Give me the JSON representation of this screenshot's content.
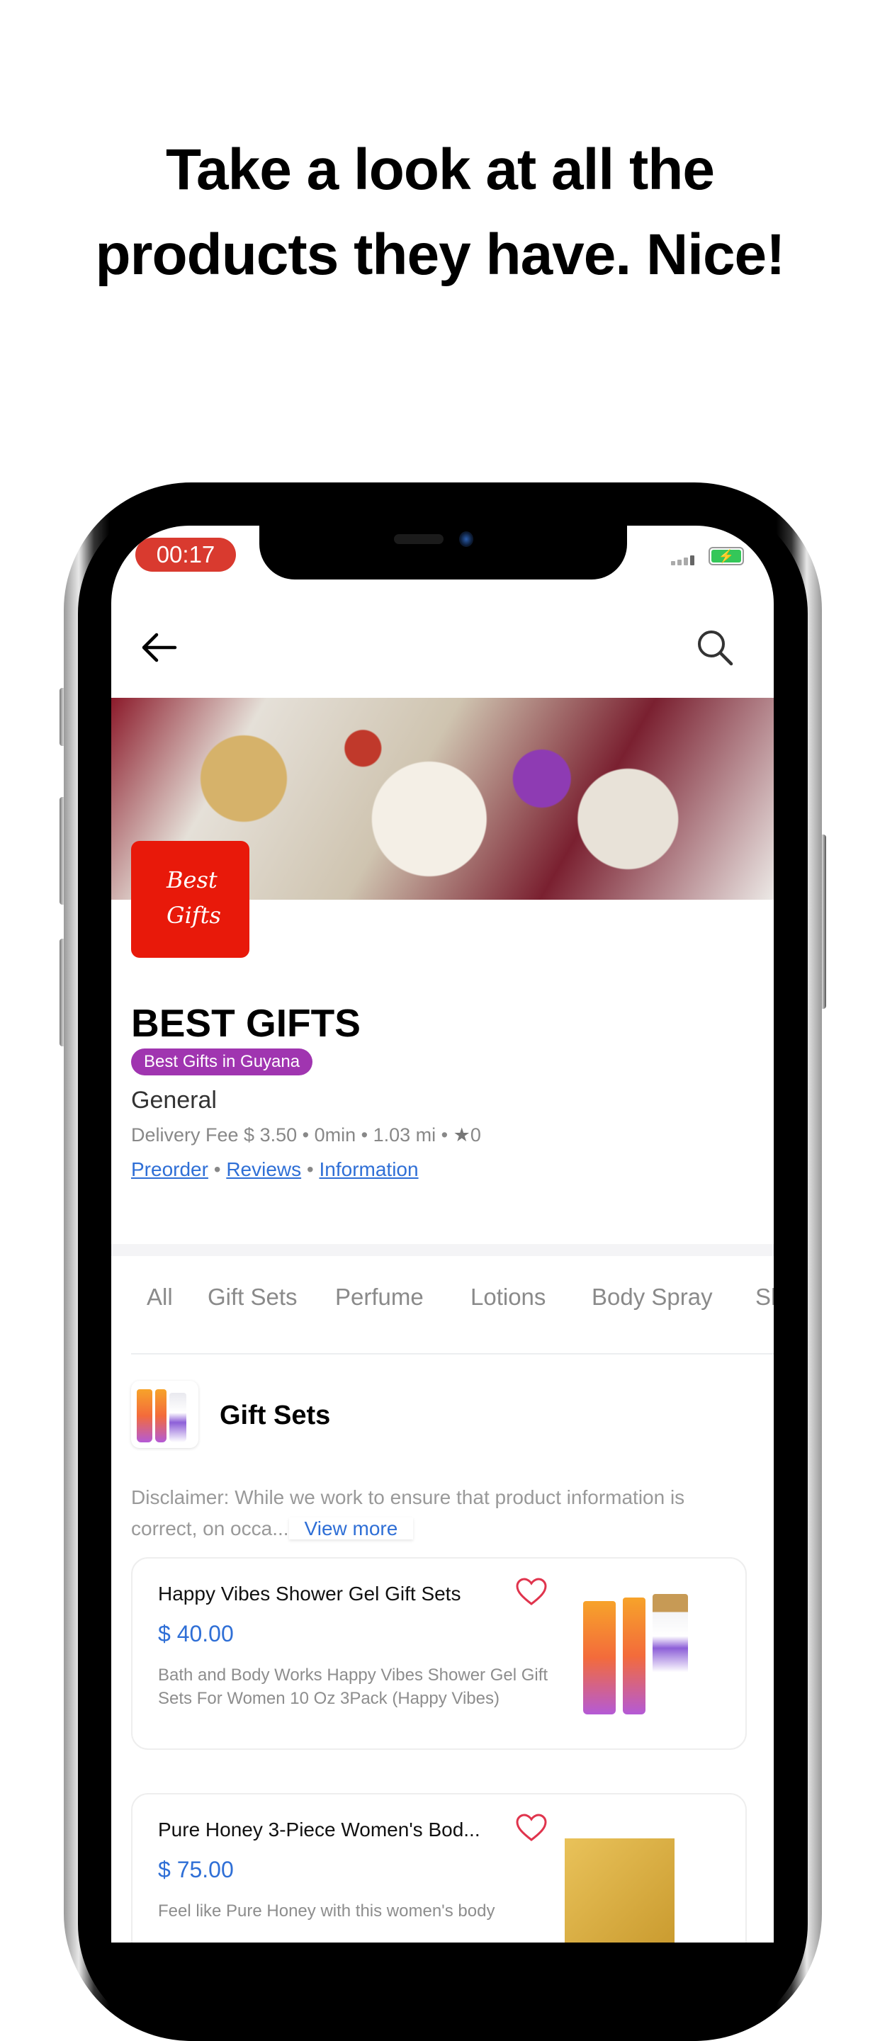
{
  "headline": {
    "line1": "Take a look at all the",
    "line2": "products they have. Nice!"
  },
  "status_bar": {
    "timer": "00:17",
    "battery_charging": true
  },
  "store": {
    "logo_text1": "Best",
    "logo_text2": "Gifts",
    "name": "BEST GIFTS",
    "badge": "Best Gifts in Guyana",
    "badge_color": "#a035b0",
    "category": "General",
    "delivery_fee": "Delivery Fee $ 3.50",
    "time": "0min",
    "distance": "1.03 mi",
    "rating": "0",
    "links": [
      "Preorder",
      "Reviews",
      "Information"
    ]
  },
  "tabs": [
    "All",
    "Gift Sets",
    "Perfume",
    "Lotions",
    "Body Spray",
    "Sh"
  ],
  "section": {
    "title": "Gift Sets",
    "disclaimer": "Disclaimer: While we work to ensure that product information is correct, on occa...",
    "view_more": "View more"
  },
  "products": [
    {
      "name": "Happy Vibes Shower Gel Gift Sets",
      "price": "$ 40.00",
      "description": "Bath and Body Works Happy Vibes Shower Gel Gift Sets For Women 10 Oz 3Pack (Happy Vibes)"
    },
    {
      "name": "Pure Honey 3-Piece Women's Bod...",
      "price": "$ 75.00",
      "description": "Feel like Pure Honey with this women's body"
    }
  ],
  "colors": {
    "accent": "#2f6fd6",
    "timer": "#d93a2f",
    "heart": "#e0344d"
  }
}
